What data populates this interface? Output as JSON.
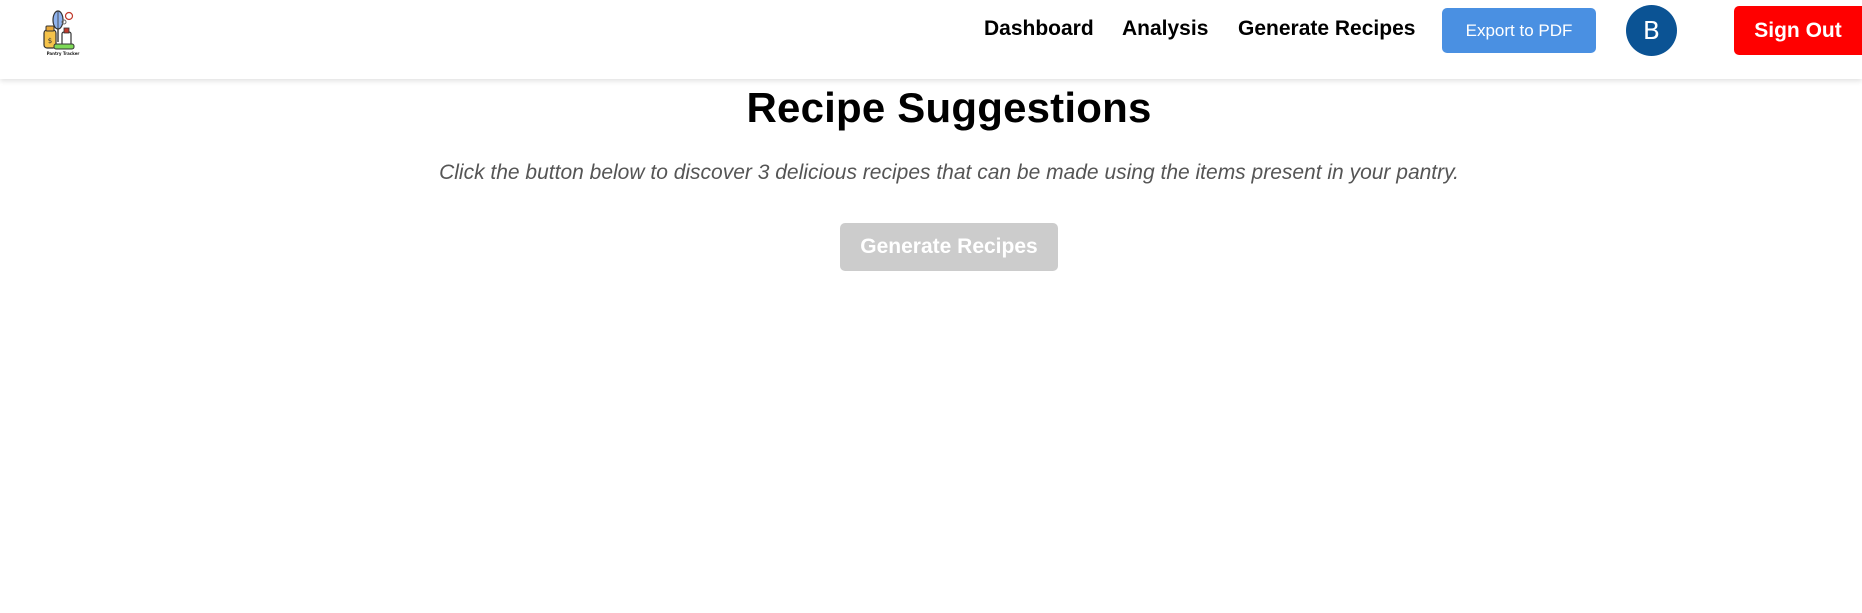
{
  "navbar": {
    "logo_text": "Pantry Tracker",
    "links": [
      {
        "label": "Dashboard"
      },
      {
        "label": "Analysis"
      },
      {
        "label": "Generate Recipes"
      }
    ],
    "export_label": "Export to PDF",
    "avatar_initial": "B",
    "signout_label": "Sign Out"
  },
  "main": {
    "title": "Recipe Suggestions",
    "subtitle": "Click the button below to discover 3 delicious recipes that can be made using the items present in your pantry.",
    "generate_label": "Generate Recipes",
    "generate_disabled": true
  },
  "colors": {
    "export_button": "#4a90e2",
    "avatar": "#0b5394",
    "signout_button": "#ff0000",
    "generate_button_disabled": "#cccccc"
  }
}
